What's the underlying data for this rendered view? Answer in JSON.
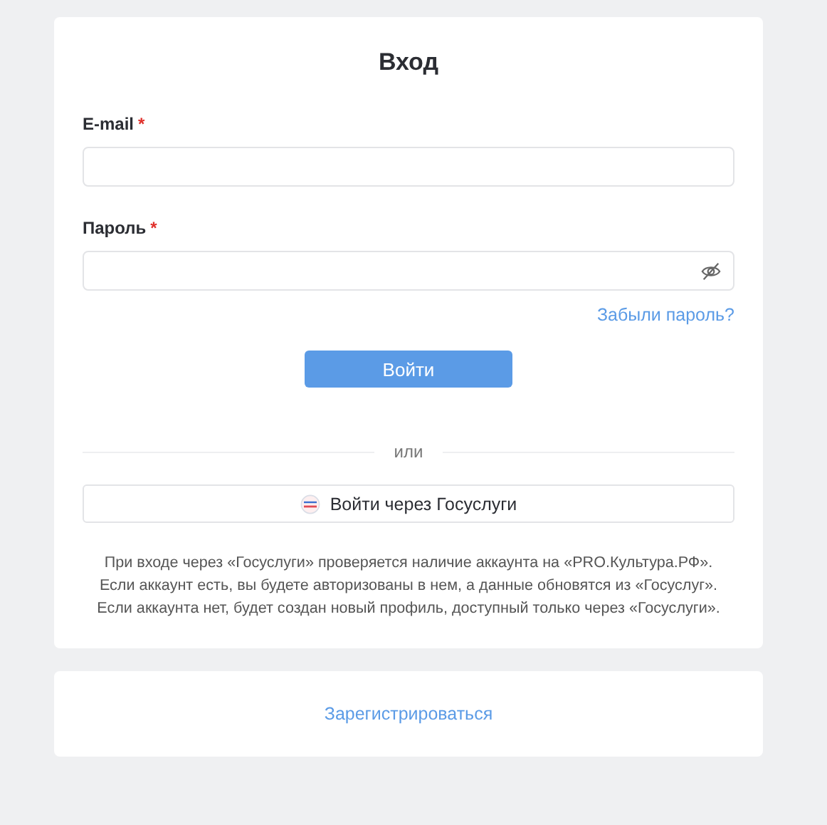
{
  "login": {
    "title": "Вход",
    "fields": [
      {
        "label": "E-mail",
        "required_mark": "*",
        "kind": "text"
      },
      {
        "label": "Пароль",
        "required_mark": "*",
        "kind": "password"
      }
    ],
    "forgot_link": "Забыли пароль?",
    "submit_button": "Войти",
    "separator": "или",
    "gosuslugi_button": "Войти через Госуслуги",
    "info_lines": [
      "При входе через «Госуслуги» проверяется наличие аккаунта на «PRO.Культура.РФ».",
      "Если аккаунт есть, вы будете авторизованы в нем, а данные обновятся из «Госуслуг».",
      "Если аккаунта нет, будет создан новый профиль, доступный только через «Госуслуги»."
    ]
  },
  "register": {
    "link": "Зарегистрироваться"
  }
}
